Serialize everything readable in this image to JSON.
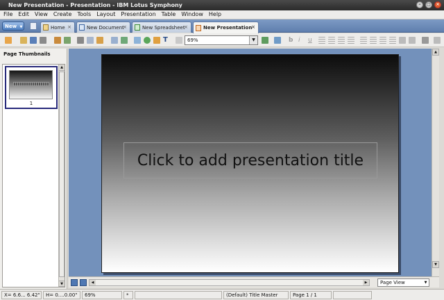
{
  "window": {
    "title": "New Presentation - Presentation - IBM Lotus Symphony"
  },
  "menu": {
    "items": [
      "File",
      "Edit",
      "View",
      "Create",
      "Tools",
      "Layout",
      "Presentation",
      "Table",
      "Window",
      "Help"
    ]
  },
  "tabbar": {
    "new_label": "New",
    "tabs": [
      {
        "label": "Home",
        "icon": "home-icon"
      },
      {
        "label": "New Document",
        "icon": "document-icon"
      },
      {
        "label": "New Spreadsheet",
        "icon": "spreadsheet-icon"
      },
      {
        "label": "New Presentation",
        "icon": "presentation-icon",
        "active": true
      }
    ]
  },
  "toolbar": {
    "zoom": "69%"
  },
  "panel": {
    "title": "Page Thumbnails",
    "thumbnails": [
      {
        "number": "1"
      }
    ]
  },
  "slide": {
    "title_placeholder": "Click to add presentation title"
  },
  "view": {
    "mode": "Page View"
  },
  "status": {
    "position": "X= 6.6... 6.42\"",
    "size": "H= 0....0.00\"",
    "zoom": "69%",
    "modified": "*",
    "master": "(Default) Title Master",
    "page": "Page 1 / 1"
  },
  "colors": {
    "workspace_bg": "#7391bb",
    "tabbar_bg": "#5f7fae",
    "thumbnail_border": "#26287a"
  }
}
